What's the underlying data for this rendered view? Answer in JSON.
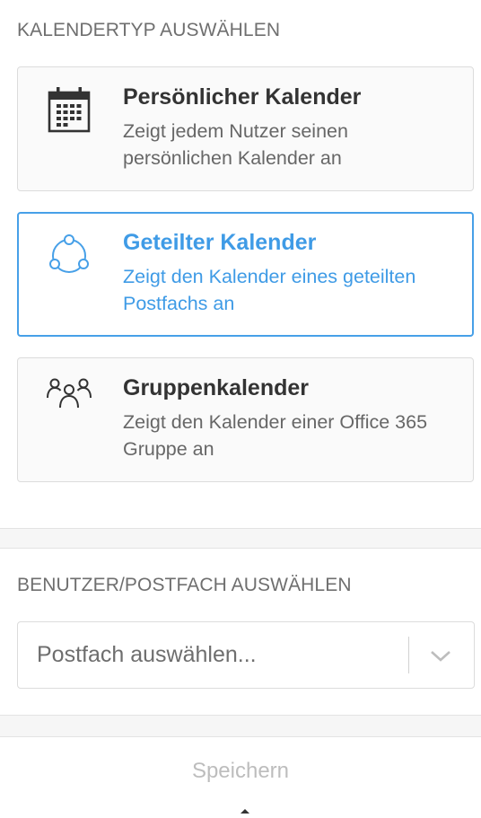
{
  "calendar_type_section": {
    "heading": "KALENDERTYP AUSWÄHLEN",
    "options": [
      {
        "title": "Persönlicher Kalender",
        "description": "Zeigt jedem Nutzer seinen persönlichen Kalender an",
        "icon": "calendar-icon",
        "selected": false
      },
      {
        "title": "Geteilter Kalender",
        "description": "Zeigt den Kalender eines geteilten Postfachs an",
        "icon": "shared-network-icon",
        "selected": true
      },
      {
        "title": "Gruppenkalender",
        "description": "Zeigt den Kalender einer Office 365 Gruppe an",
        "icon": "group-people-icon",
        "selected": false
      }
    ]
  },
  "mailbox_section": {
    "heading": "BENUTZER/POSTFACH AUSWÄHLEN",
    "select": {
      "placeholder": "Postfach auswählen...",
      "icon": "chevron-down-icon"
    }
  },
  "footer": {
    "save_label": "Speichern"
  },
  "colors": {
    "accent": "#47a0e8",
    "text": "#333333",
    "muted": "#676767",
    "disabled": "#bdbdbd"
  }
}
